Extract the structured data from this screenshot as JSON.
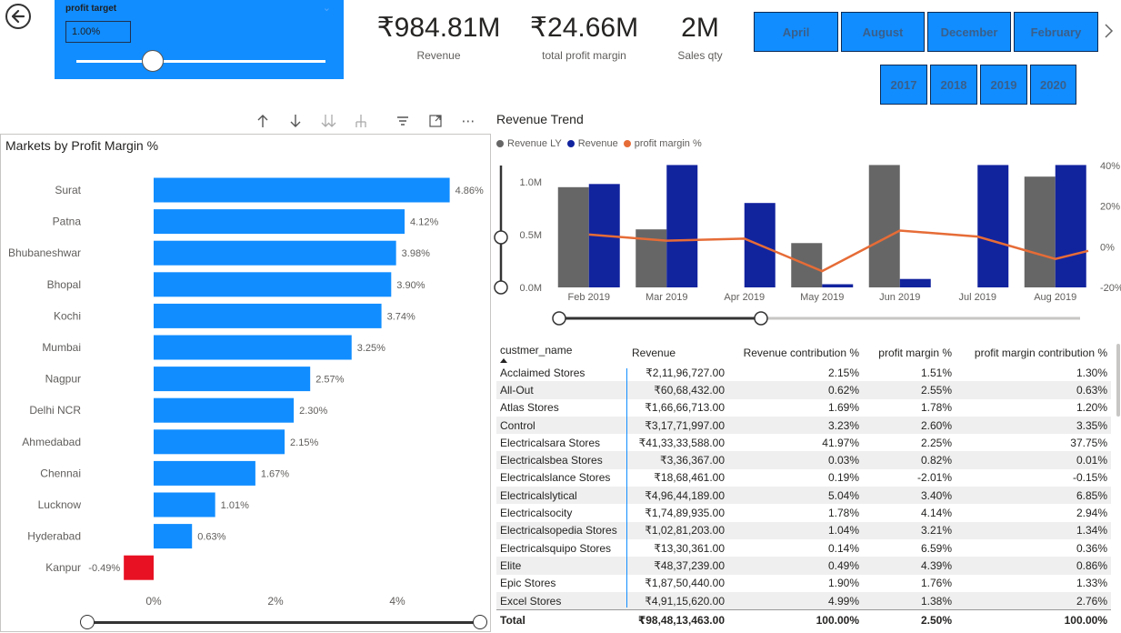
{
  "slicer": {
    "title": "profit target",
    "value": "1.00%",
    "level_percent": 1.0
  },
  "kpis": [
    {
      "value": "₹984.81M",
      "label": "Revenue"
    },
    {
      "value": "₹24.66M",
      "label": "total profit margin"
    },
    {
      "value": "2M",
      "label": "Sales qty"
    }
  ],
  "months": [
    "April",
    "August",
    "December",
    "February"
  ],
  "years": [
    "2017",
    "2018",
    "2019",
    "2020"
  ],
  "markets_chart": {
    "title": "Markets by Profit Margin %",
    "colors": {
      "positive": "#118DFF",
      "negative": "#E81123"
    }
  },
  "trend": {
    "title": "Revenue Trend",
    "legend": [
      {
        "name": "Revenue LY",
        "color": "#666666"
      },
      {
        "name": "Revenue",
        "color": "#12239E"
      },
      {
        "name": "profit margin %",
        "color": "#E66C37"
      }
    ]
  },
  "chart_data": [
    {
      "type": "bar",
      "title": "Markets by Profit Margin %",
      "categories": [
        "Surat",
        "Patna",
        "Bhubaneshwar",
        "Bhopal",
        "Kochi",
        "Mumbai",
        "Nagpur",
        "Delhi NCR",
        "Ahmedabad",
        "Chennai",
        "Lucknow",
        "Hyderabad",
        "Kanpur"
      ],
      "values": [
        4.86,
        4.12,
        3.98,
        3.9,
        3.74,
        3.25,
        2.57,
        2.3,
        2.15,
        1.67,
        1.01,
        0.63,
        -0.49
      ],
      "labels": [
        "4.86%",
        "4.12%",
        "3.98%",
        "3.90%",
        "3.74%",
        "3.25%",
        "2.57%",
        "2.30%",
        "2.15%",
        "1.67%",
        "1.01%",
        "0.63%",
        "-0.49%"
      ],
      "xticks": [
        "0%",
        "2%",
        "4%"
      ],
      "xlim": [
        -0.6,
        5.0
      ],
      "orientation": "horizontal"
    },
    {
      "type": "bar",
      "title": "Revenue Trend",
      "categories": [
        "Feb 2019",
        "Mar 2019",
        "Apr 2019",
        "May 2019",
        "Jun 2019",
        "Jul 2019",
        "Aug 2019"
      ],
      "series": [
        {
          "name": "Revenue LY",
          "values": [
            0.95,
            0.55,
            0,
            0.42,
            1.25,
            0,
            1.05
          ]
        },
        {
          "name": "Revenue",
          "values": [
            0.98,
            1.25,
            0.8,
            0.03,
            0.08,
            1.25,
            1.25
          ]
        }
      ],
      "line": {
        "name": "profit margin %",
        "values": [
          6,
          3,
          4,
          -12,
          8,
          5,
          -6,
          -2
        ]
      },
      "yticks": [
        "0.0M",
        "0.5M",
        "1.0M"
      ],
      "ylim": [
        0,
        1.2
      ],
      "y2ticks": [
        "40%",
        "20%",
        "0%",
        "-20%"
      ],
      "y2lim": [
        -20,
        40
      ]
    }
  ],
  "table": {
    "columns": [
      "custmer_name",
      "Revenue",
      "Revenue contribution %",
      "profit margin %",
      "profit margin contribution %"
    ],
    "rows": [
      [
        "Acclaimed Stores",
        "₹2,11,96,727.00",
        "2.15%",
        "1.51%",
        "1.30%"
      ],
      [
        "All-Out",
        "₹60,68,432.00",
        "0.62%",
        "2.55%",
        "0.63%"
      ],
      [
        "Atlas Stores",
        "₹1,66,66,713.00",
        "1.69%",
        "1.78%",
        "1.20%"
      ],
      [
        "Control",
        "₹3,17,71,997.00",
        "3.23%",
        "2.60%",
        "3.35%"
      ],
      [
        "Electricalsara Stores",
        "₹41,33,33,588.00",
        "41.97%",
        "2.25%",
        "37.75%"
      ],
      [
        "Electricalsbea Stores",
        "₹3,36,367.00",
        "0.03%",
        "0.82%",
        "0.01%"
      ],
      [
        "Electricalslance Stores",
        "₹18,68,461.00",
        "0.19%",
        "-2.01%",
        "-0.15%"
      ],
      [
        "Electricalslytical",
        "₹4,96,44,189.00",
        "5.04%",
        "3.40%",
        "6.85%"
      ],
      [
        "Electricalsocity",
        "₹1,74,89,935.00",
        "1.78%",
        "4.14%",
        "2.94%"
      ],
      [
        "Electricalsopedia Stores",
        "₹1,02,81,203.00",
        "1.04%",
        "3.21%",
        "1.34%"
      ],
      [
        "Electricalsquipo Stores",
        "₹13,30,361.00",
        "0.14%",
        "6.59%",
        "0.36%"
      ],
      [
        "Elite",
        "₹48,37,239.00",
        "0.49%",
        "4.39%",
        "0.86%"
      ],
      [
        "Epic Stores",
        "₹1,87,50,440.00",
        "1.90%",
        "1.76%",
        "1.33%"
      ],
      [
        "Excel Stores",
        "₹4,91,15,620.00",
        "4.99%",
        "1.38%",
        "2.76%"
      ]
    ],
    "total": [
      "Total",
      "₹98,48,13,463.00",
      "100.00%",
      "2.50%",
      "100.00%"
    ]
  }
}
